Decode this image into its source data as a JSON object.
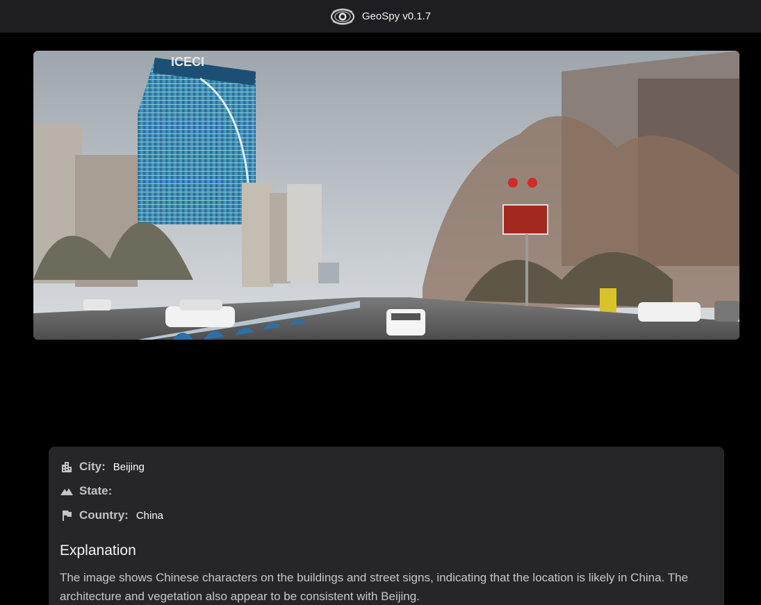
{
  "header": {
    "title": "GeoSpy v0.1.7",
    "logo_icon": "eye-icon"
  },
  "photo": {
    "subject": "street-view-photo",
    "building_sign_text": "ICECI"
  },
  "result": {
    "city": {
      "icon": "city-building-icon",
      "label": "City:",
      "value": "Beijing"
    },
    "state": {
      "icon": "terrain-icon",
      "label": "State:",
      "value": ""
    },
    "country": {
      "icon": "flag-icon",
      "label": "Country:",
      "value": "China"
    },
    "explanation_title": "Explanation",
    "explanation_text": "The image shows Chinese characters on the buildings and street signs, indicating that the location is likely in China. The architecture and vegetation also appear to be consistent with Beijing."
  },
  "colors": {
    "background": "#000000",
    "topbar": "#1e1e22",
    "card": "#262628",
    "label": "#c4c4c8"
  }
}
